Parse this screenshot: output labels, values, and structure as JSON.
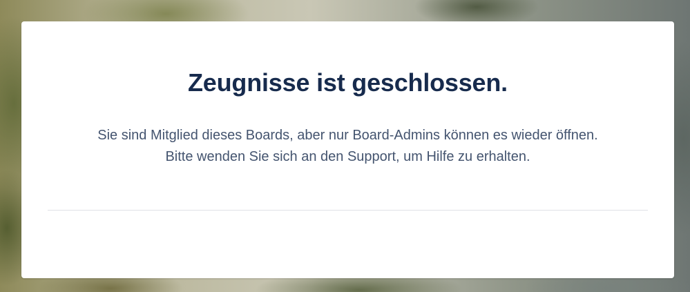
{
  "dialog": {
    "title": "Zeugnisse ist geschlossen.",
    "message_line1": "Sie sind Mitglied dieses Boards, aber nur Board-Admins können es wieder öffnen.",
    "message_line2": "Bitte wenden Sie sich an den Support, um Hilfe zu erhalten."
  },
  "colors": {
    "title": "#172b4d",
    "body_text": "#44546f",
    "divider": "#dfe1e6",
    "card_background": "#ffffff"
  }
}
